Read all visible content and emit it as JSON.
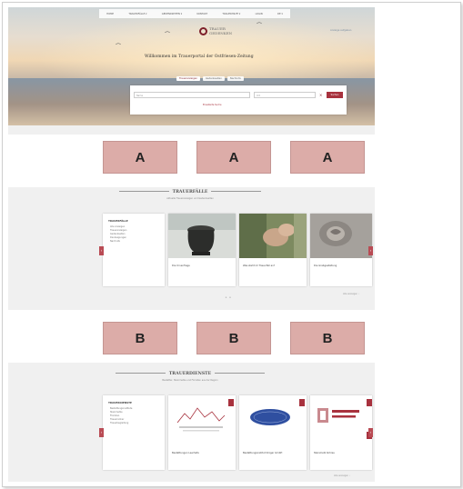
{
  "nav": {
    "items": [
      "HOME",
      "TRAUERFÄLLE ▾",
      "GEDENKSEITEN ▾",
      "KONTAKT",
      "TRAUERHILFE ▾",
      "LOGIN",
      "DE ▾"
    ]
  },
  "header": {
    "logo_line1": "TRAUER",
    "logo_line2": "GEDENKEN",
    "welcome": "Willkommen im Trauerportal der Ostfriesen-Zeitung",
    "right_link": "Anzeige aufgeben"
  },
  "search": {
    "tabs": [
      "Traueranzeigen",
      "Gedenkseiten",
      "Nachrufe"
    ],
    "name_placeholder": "Name",
    "place_placeholder": "Ort",
    "clear_glyph": "×",
    "button_label": "Suchen",
    "advanced_link": "Erweiterte Suche"
  },
  "ads_top": {
    "label": "A"
  },
  "ads_bottom": {
    "label": "B"
  },
  "trauerfaelle": {
    "title": "TRAUERFÄLLE",
    "subtitle": "Aktuelle Traueranzeigen und Gedenkseiten",
    "filter_title": "TRAUERFÄLLE",
    "filter_items": [
      "Alle Anzeigen",
      "Traueranzeigen",
      "Gedenkseiten",
      "Danksagungen",
      "Nachrufe"
    ],
    "cards": [
      {
        "caption": "Die Urnenfrage"
      },
      {
        "caption": "Was steht im Trauerfall an?"
      },
      {
        "caption": "Die Grabgestaltung"
      }
    ],
    "more": "Alle anzeigen ›"
  },
  "trauerdienste": {
    "title": "TRAUERDIENSTE",
    "subtitle": "Bestatter, Steinmetze und Floristen aus der Region",
    "filter_title": "TRAUERDIENSTE",
    "filter_items": [
      "Bestattungsinstitute",
      "Steinmetze",
      "Floristen",
      "Trauerredner",
      "Trauerbegleitung"
    ],
    "cards": [
      {
        "caption": "Bestattungen Leerhafe"
      },
      {
        "caption": "Bestattungsinstitut Krüger GmbH"
      },
      {
        "caption": "Steinmetz Kohres"
      }
    ],
    "more": "Alle anzeigen ›"
  },
  "colors": {
    "accent": "#a8323e",
    "ad": "#dcaca8"
  }
}
